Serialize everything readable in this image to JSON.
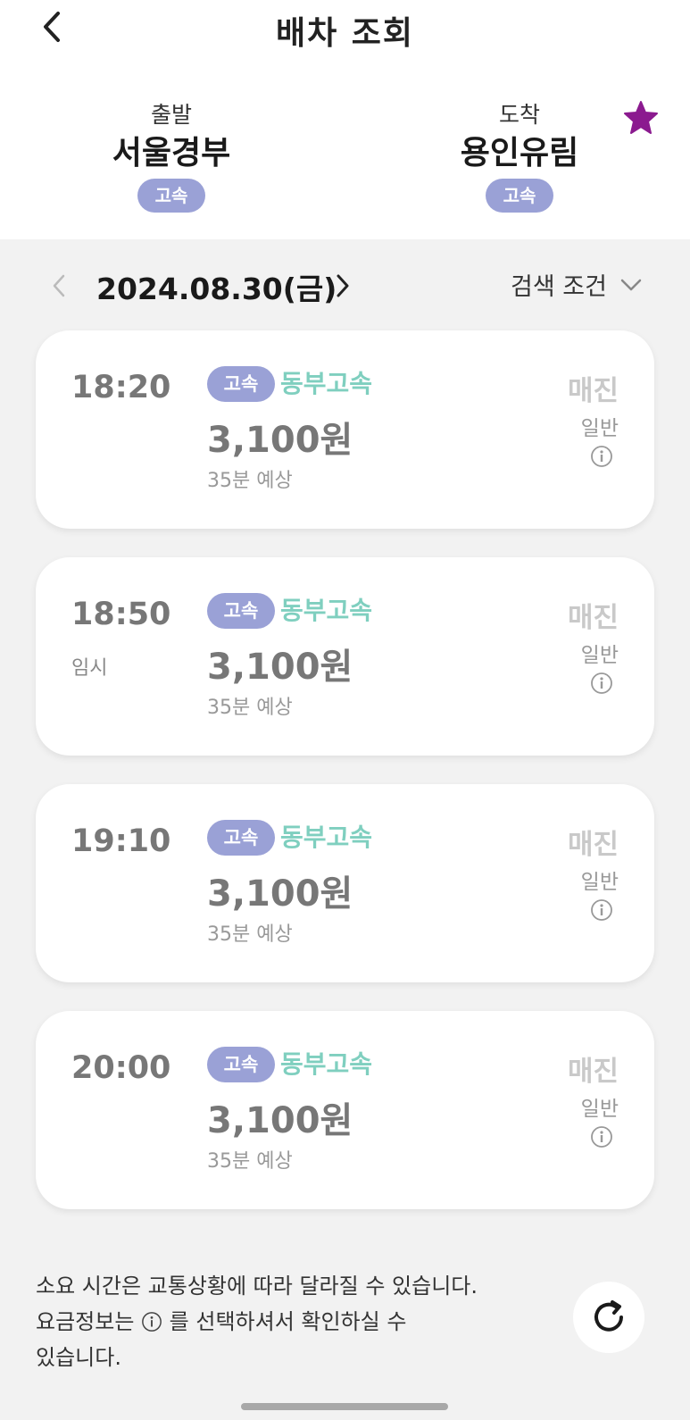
{
  "header": {
    "title": "배차 조회"
  },
  "route": {
    "departure": {
      "caption": "출발",
      "name": "서울경부",
      "badge": "고속"
    },
    "arrival": {
      "caption": "도착",
      "name": "용인유림",
      "badge": "고속"
    }
  },
  "date_bar": {
    "date": "2024.08.30(금)",
    "filter_label": "검색 조건"
  },
  "schedules": [
    {
      "time": "18:20",
      "note": "",
      "grade": "고속",
      "company": "동부고속",
      "fare": "3,100원",
      "duration": "35분 예상",
      "status": "매진",
      "seat_type": "일반"
    },
    {
      "time": "18:50",
      "note": "임시",
      "grade": "고속",
      "company": "동부고속",
      "fare": "3,100원",
      "duration": "35분 예상",
      "status": "매진",
      "seat_type": "일반"
    },
    {
      "time": "19:10",
      "note": "",
      "grade": "고속",
      "company": "동부고속",
      "fare": "3,100원",
      "duration": "35분 예상",
      "status": "매진",
      "seat_type": "일반"
    },
    {
      "time": "20:00",
      "note": "",
      "grade": "고속",
      "company": "동부고속",
      "fare": "3,100원",
      "duration": "35분 예상",
      "status": "매진",
      "seat_type": "일반"
    }
  ],
  "notice": {
    "line1": "소요 시간은 교통상황에 따라 달라질 수 있습니다.",
    "line2_before": "요금정보는 ",
    "line2_after": " 를 선택하셔서 확인하실 수",
    "line3": "있습니다."
  },
  "colors": {
    "accent_badge": "#9aa1d6",
    "company": "#7fcfbf",
    "favorite_star": "#8b1a8f"
  },
  "icons": {
    "back": "chevron-left-icon",
    "favorite": "star-icon",
    "prev": "chevron-left-icon",
    "next": "chevron-right-icon",
    "filter": "chevron-down-icon",
    "info": "info-circle-icon",
    "refresh": "refresh-icon"
  }
}
